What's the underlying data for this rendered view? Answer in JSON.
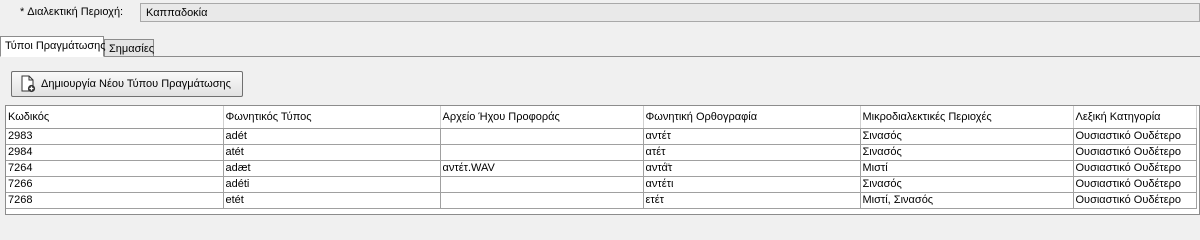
{
  "field": {
    "required_mark": "*",
    "label": "Διαλεκτική Περιοχή:",
    "value": "Καππαδοκία"
  },
  "tabs": [
    {
      "label": "Τύποι Πραγμάτωσης",
      "active": true
    },
    {
      "label": "Σημασίες",
      "active": false
    }
  ],
  "toolbar": {
    "create_label": "Δημιουργία Νέου Τύπου Πραγμάτωσης",
    "create_icon": "new-document-icon"
  },
  "table": {
    "headers": [
      "Κωδικός",
      "Φωνητικός Τύπος",
      "Αρχείο Ήχου Προφοράς",
      "Φωνητική Ορθογραφία",
      "Μικροδιαλεκτικές Περιοχές",
      "Λεξική Κατηγορία"
    ],
    "rows": [
      [
        "2983",
        "adét",
        "",
        "αντέτ",
        "Σινασός",
        "Ουσιαστικό Ουδέτερο"
      ],
      [
        "2984",
        "atét",
        "",
        "ατέτ",
        "Σινασός",
        "Ουσιαστικό Ουδέτερο"
      ],
      [
        "7264",
        "adæt",
        "αντέτ.WAV",
        "αντά̈τ",
        "Μιστί",
        "Ουσιαστικό Ουδέτερο"
      ],
      [
        "7266",
        "adéti",
        "",
        "αντέτι",
        "Σινασός",
        "Ουσιαστικό Ουδέτερο"
      ],
      [
        "7268",
        "etét",
        "",
        "ετέτ",
        "Μιστί, Σινασός",
        "Ουσιαστικό Ουδέτερο"
      ]
    ]
  }
}
